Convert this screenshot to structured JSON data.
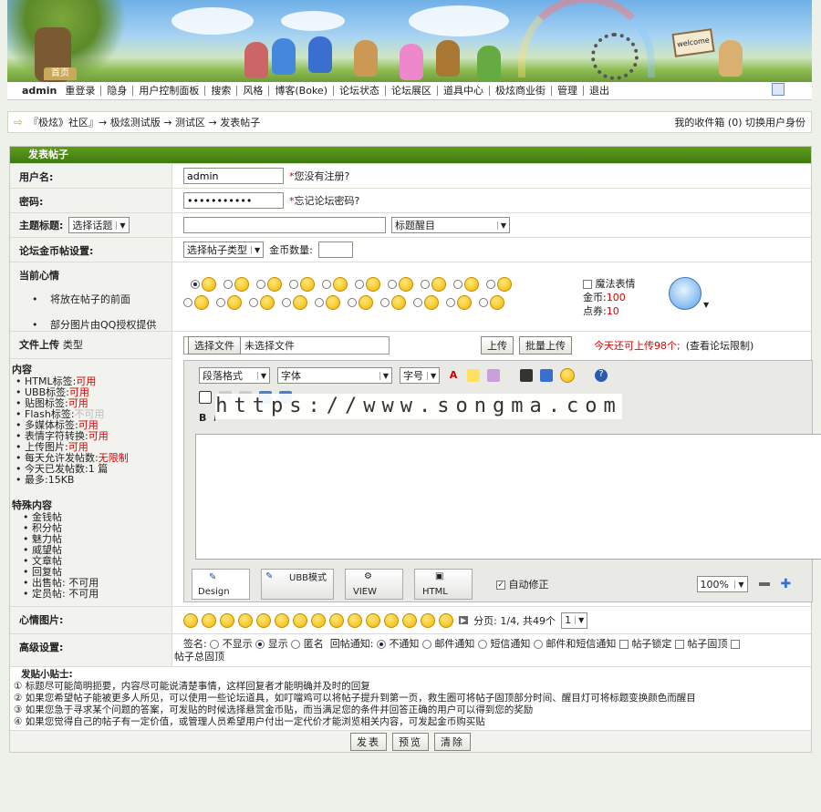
{
  "banner": {
    "home_tab": "首页",
    "sign": "welcome"
  },
  "nav": {
    "username": "admin",
    "items": [
      "重登录",
      "隐身",
      "用户控制面板",
      "搜索",
      "风格",
      "博客(Boke)",
      "论坛状态",
      "论坛展区",
      "道具中心",
      "极炫商业街",
      "管理",
      "退出"
    ]
  },
  "crumbs": {
    "path": "『极炫》社区』→ 极炫测试版 → 测试区 → 发表帖子",
    "right": "我的收件箱 (0)  切换用户身份"
  },
  "form": {
    "title": "发表帖子",
    "username_label": "用户名:",
    "username_value": "admin",
    "username_hint": "您没有注册?",
    "password_label": "密码:",
    "password_value": "•••••••••••",
    "password_hint": "忘记论坛密码?",
    "subject_label": "主题标题:",
    "topic_select": "选择话题",
    "highlight_select": "标题醒目",
    "coin_label": "论坛金币帖设置:",
    "post_type_select": "选择帖子类型",
    "coin_amount_label": "金币数量:",
    "mood_label": "当前心情",
    "mood_notes": [
      "将放在帖子的前面",
      "部分图片由QQ授权提供"
    ],
    "magic_face": "魔法表情",
    "gold_label": "金币:",
    "gold_value": "100",
    "coupon_label": "点券:",
    "coupon_value": "10",
    "upload_label": "文件上传",
    "upload_type": "类型",
    "choose_file": "选择文件",
    "no_file": "未选择文件",
    "upload_btn": "上传",
    "batch_upload_btn": "批量上传",
    "upload_remaining": "今天还可上传98个;",
    "upload_limits": "(查看论坛限制)",
    "content_label": "内容",
    "content_rules": [
      {
        "k": "HTML标签:",
        "v": "可用",
        "c": "#d00"
      },
      {
        "k": "UBB标签:",
        "v": "可用",
        "c": "#d00"
      },
      {
        "k": "贴图标签:",
        "v": "可用",
        "c": "#d00"
      },
      {
        "k": "Flash标签:",
        "v": "不可用",
        "c": "#bbb"
      },
      {
        "k": "多媒体标签:",
        "v": "可用",
        "c": "#d00"
      },
      {
        "k": "表情字符转换:",
        "v": "可用",
        "c": "#d00"
      },
      {
        "k": "上传图片:",
        "v": "可用",
        "c": "#d00"
      },
      {
        "k": "每天允许发帖数:",
        "v": "无限制",
        "c": "#d00"
      },
      {
        "k": "今天已发帖数:",
        "v": "1 篇",
        "c": "#222"
      },
      {
        "k": "最多:",
        "v": "15KB",
        "c": "#222"
      }
    ],
    "special_label": "特殊内容",
    "special_items": [
      "金钱帖",
      "积分帖",
      "魅力帖",
      "威望帖",
      "文章帖",
      "回复帖",
      "出售帖: 不可用",
      "定员帖: 不可用"
    ],
    "editor": {
      "para_select": "段落格式",
      "font_select": "字体",
      "size_select": "字号",
      "modes": [
        "Design",
        "UBB模式",
        "VIEW",
        "HTML"
      ],
      "autofix": "自动修正",
      "zoom": "100%"
    },
    "watermark": "https://www.songma.com",
    "emotion_label": "心情图片:",
    "page_info": "分页: 1/4, 共49个",
    "page_select": "1",
    "advanced_label": "高级设置:",
    "adv": {
      "sign": "签名:",
      "no_show": "不显示",
      "show": "显示",
      "anon": "匿名",
      "reply_notify": "回帖通知:",
      "no_notify": "不通知",
      "mail_notify": "邮件通知",
      "sms_notify": "短信通知",
      "mail_sms_notify": "邮件和短信通知",
      "lock": "帖子锁定",
      "top": "帖子固顶",
      "all_top": "帖子总固顶"
    },
    "tips_title": "发贴小贴士:",
    "tips": [
      "① 标题尽可能简明扼要，内容尽可能说清楚事情，这样回复者才能明确并及时的回复",
      "② 如果您希望帖子能被更多人所见，可以使用一些论坛道具，如叮噹鸡可以将帖子提升到第一页，救生圈可将帖子固顶部分时间、醒目灯可将标题变换颜色而醒目",
      "③ 如果您急于寻求某个问题的答案，可发贴的时候选择悬赏金币贴，而当满足您的条件并回答正确的用户可以得到您的奖励",
      "④ 如果您觉得自己的帖子有一定价值，或管理人员希望用户付出一定代价才能浏览相关内容，可发起金币购买贴"
    ],
    "buttons": {
      "submit": "发表",
      "preview": "预览",
      "clear": "清除"
    }
  }
}
